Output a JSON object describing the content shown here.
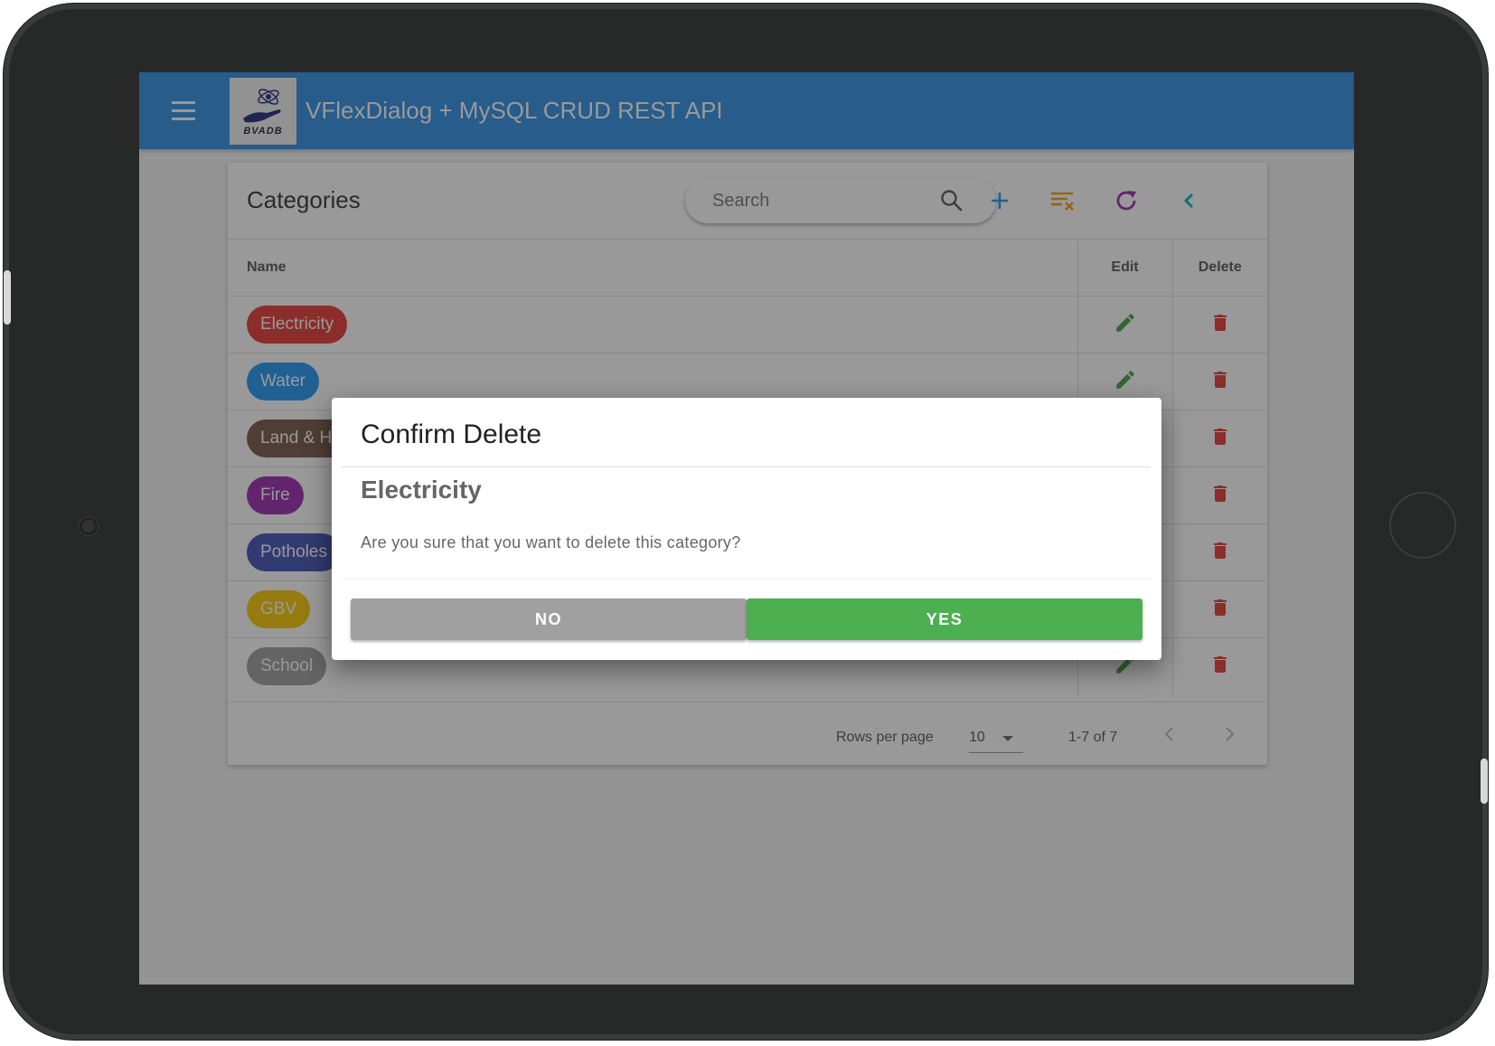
{
  "app": {
    "title": "VFlexDialog + MySQL CRUD REST API",
    "logo_text": "BVADB"
  },
  "card": {
    "title": "Categories",
    "search": {
      "placeholder": "Search",
      "value": ""
    },
    "toolbar": [
      "add-icon",
      "clear-filter-icon",
      "refresh-icon",
      "collapse-icon"
    ],
    "columns": {
      "name": "Name",
      "edit": "Edit",
      "delete": "Delete"
    },
    "rows": [
      {
        "name": "Electricity",
        "color": "#e53935"
      },
      {
        "name": "Water",
        "color": "#2196f3"
      },
      {
        "name": "Land & Housing",
        "color": "#795548"
      },
      {
        "name": "Fire",
        "color": "#9c27b0"
      },
      {
        "name": "Potholes",
        "color": "#3f51b5"
      },
      {
        "name": "GBV",
        "color": "#f9c800"
      },
      {
        "name": "School",
        "color": "#9e9e9e"
      }
    ],
    "footer": {
      "rows_per_page_label": "Rows per page",
      "rows_per_page_value": "10",
      "range": "1-7 of 7"
    }
  },
  "colors": {
    "appbar": "#2d8fe6",
    "edit": "#43a047",
    "delete": "#e53935",
    "yes": "#4caf50",
    "no": "#a0a0a0"
  },
  "dialog": {
    "title": "Confirm Delete",
    "subtitle": "Electricity",
    "message": "Are you sure that you want to delete this category?",
    "no_label": "NO",
    "yes_label": "YES"
  }
}
